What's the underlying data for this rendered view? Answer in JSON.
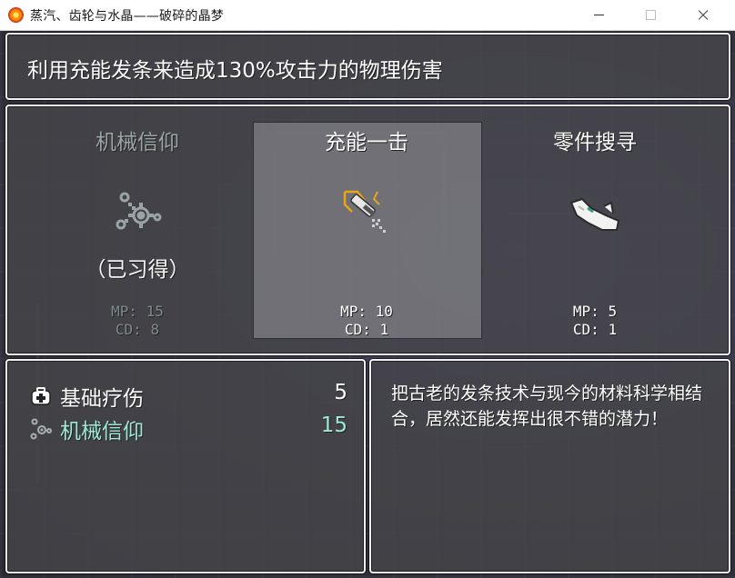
{
  "window": {
    "title": "蒸汽、齿轮与水晶——破碎的晶梦"
  },
  "help": {
    "text": "利用充能发条来造成130%攻击力的物理伤害"
  },
  "skills": [
    {
      "name": "机械信仰",
      "icon": "gear-cog-icon",
      "status": "（已习得）",
      "mp": "MP: 15",
      "cd": "CD: 8",
      "learned": true
    },
    {
      "name": "充能一击",
      "icon": "charged-sword-icon",
      "status": "",
      "mp": "MP: 10",
      "cd": "CD: 1",
      "learned": false,
      "selected": true
    },
    {
      "name": "零件搜寻",
      "icon": "wing-boot-icon",
      "status": "",
      "mp": "MP: 5",
      "cd": "CD: 1",
      "learned": false
    }
  ],
  "learned_list": [
    {
      "name": "基础疗伤",
      "icon": "medkit-icon",
      "cost": "5"
    },
    {
      "name": "机械信仰",
      "icon": "gear-cog-icon",
      "cost": "15",
      "highlighted": true
    }
  ],
  "description": {
    "text": "把古老的发条技术与现今的材料科学相结合，居然还能发挥出很不错的潜力！"
  },
  "colors": {
    "highlight_text": "#9fe8d4",
    "learned_text": "#9aa6a6",
    "panel_border": "#f2f2f2"
  }
}
